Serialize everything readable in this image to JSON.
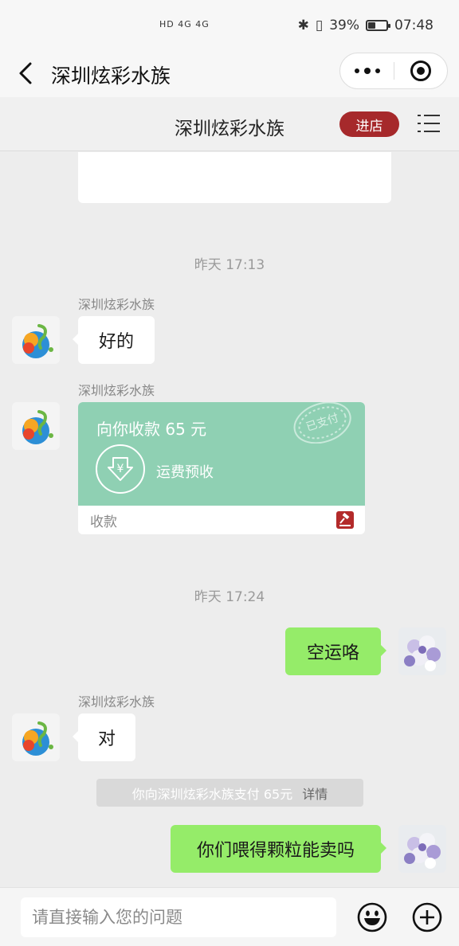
{
  "status_bar": {
    "network": "HD 4G 4G",
    "battery": "39%",
    "battery_level": 0.39,
    "time": "07:48"
  },
  "title_bar": {
    "title": "深圳炫彩水族"
  },
  "shop_header": {
    "name": "深圳炫彩水族",
    "enter_label": "进店",
    "accent_color": "#a6292b"
  },
  "messages": {
    "time1": "昨天 17:13",
    "msg1_sender": "深圳炫彩水族",
    "msg1_text": "好的",
    "msg2_sender": "深圳炫彩水族",
    "payment": {
      "amount_text": "向你收款 65 元",
      "description": "运费预收",
      "stamp": "已支付",
      "footer_label": "收款",
      "card_color": "#8fd0b3"
    },
    "time2": "昨天 17:24",
    "msg3_text": "空运咯",
    "msg4_sender": "深圳炫彩水族",
    "msg4_text": "对",
    "pay_notice_text": "你向深圳炫彩水族支付 65元",
    "pay_notice_detail": "详情",
    "msg5_text": "你们喂得颗粒能卖吗",
    "bubble_self_color": "#95ec69"
  },
  "input_bar": {
    "placeholder": "请直接输入您的问题"
  }
}
